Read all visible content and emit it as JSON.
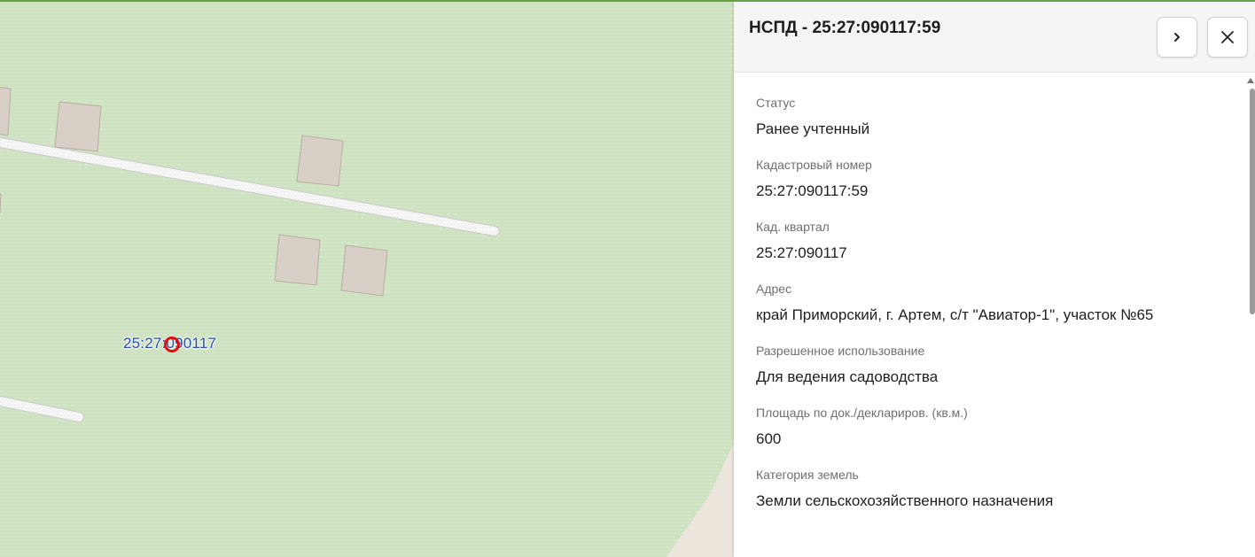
{
  "map": {
    "quarter_label": "25:27:090117",
    "marker_icon": "location-circle-icon",
    "colors": {
      "land": "#cfe3c2",
      "dots": "#ffffff",
      "building": "#d8cfc6",
      "building_border": "#b9aca0",
      "road": "#f3f3f3",
      "label": "#2b4ea8",
      "marker": "#e01010"
    }
  },
  "panel": {
    "title": "НСПД - 25:27:090117:59",
    "next_icon": "chevron-right-icon",
    "close_icon": "close-icon",
    "fields": [
      {
        "label": "Статус",
        "value": "Ранее учтенный"
      },
      {
        "label": "Кадастровый номер",
        "value": "25:27:090117:59"
      },
      {
        "label": "Кад. квартал",
        "value": "25:27:090117"
      },
      {
        "label": "Адрес",
        "value": "край Приморский, г. Артем, с/т \"Авиатор-1\", участок №65"
      },
      {
        "label": "Разрешенное использование",
        "value": "Для ведения садоводства"
      },
      {
        "label": "Площадь по док./деклариров. (кв.м.)",
        "value": "600"
      },
      {
        "label": "Категория земель",
        "value": "Земли сельскохозяйственного назначения"
      }
    ]
  }
}
